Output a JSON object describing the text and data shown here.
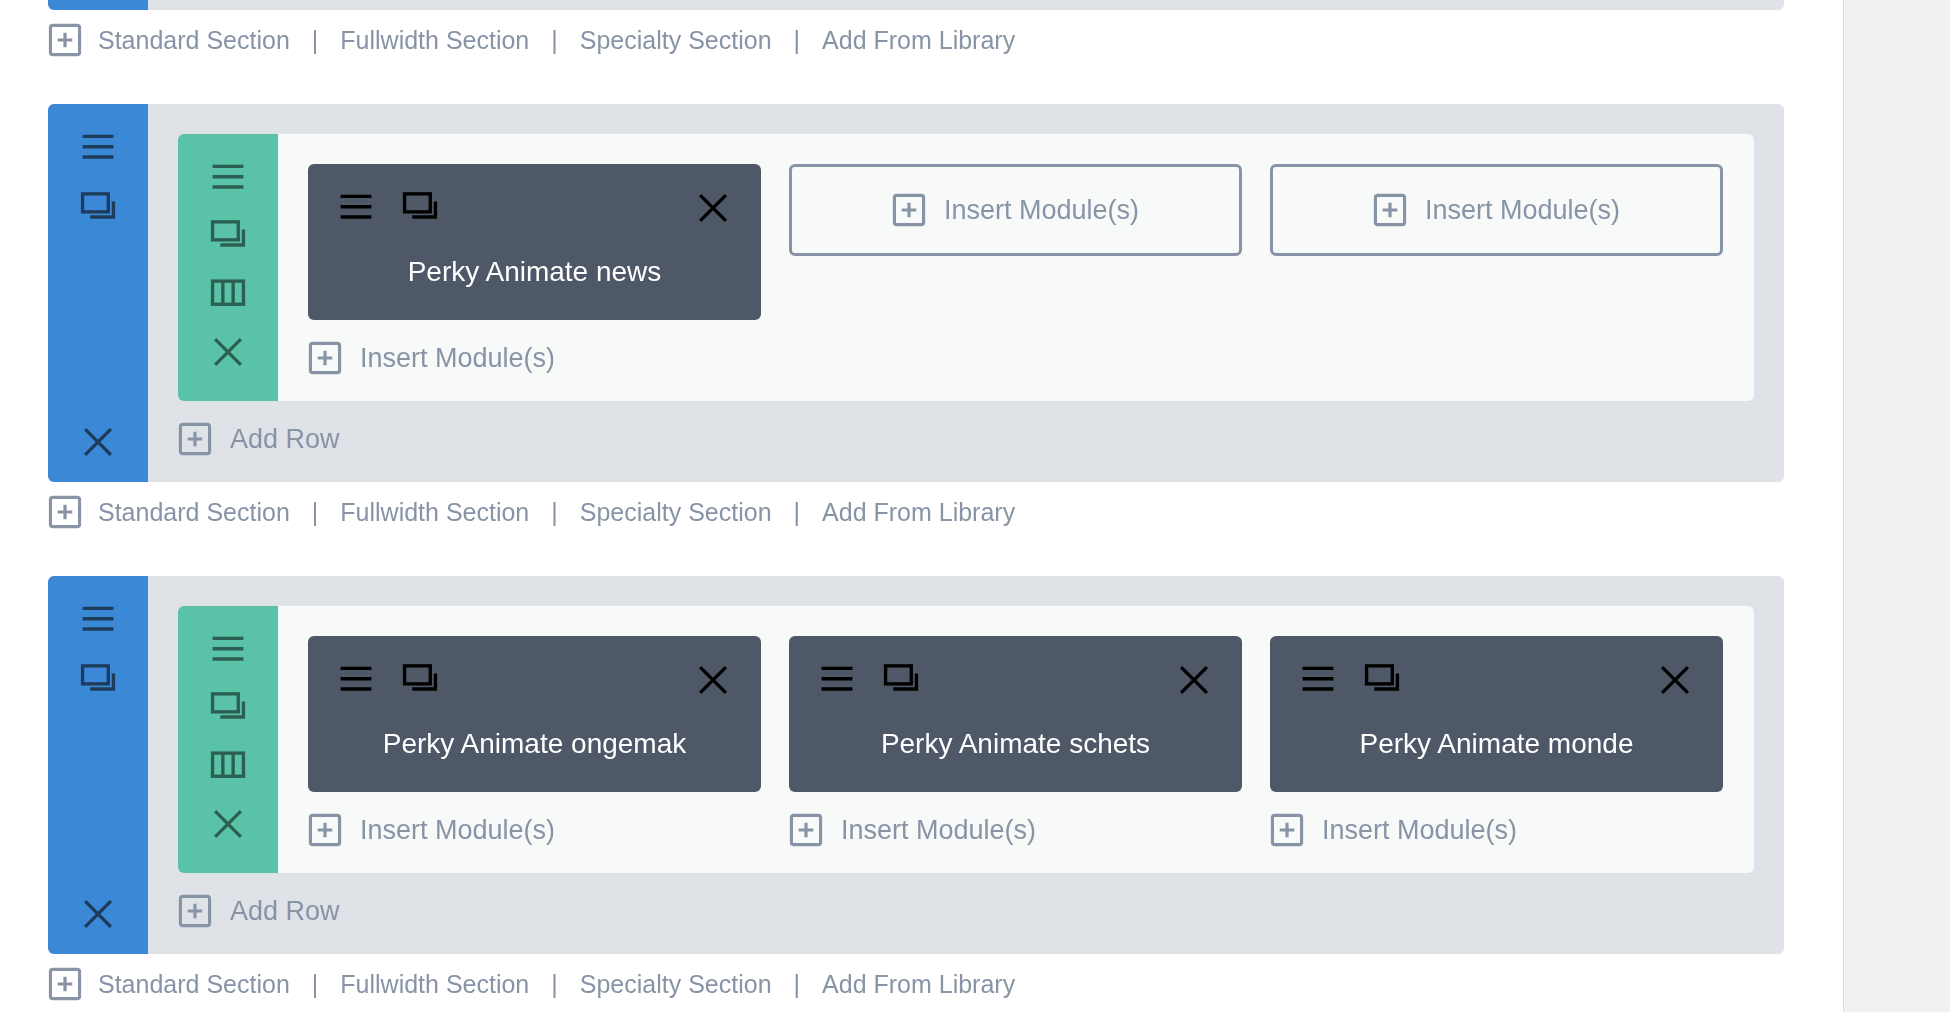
{
  "builder": [
    {
      "kind": "section_end"
    },
    {
      "kind": "add_bar",
      "separator": "|",
      "links": [
        "Standard Section",
        "Fullwidth Section",
        "Specialty Section",
        "Add From Library"
      ]
    },
    {
      "kind": "section",
      "add_row": "Add Row",
      "rows": [
        {
          "columns": [
            {
              "modules": [
                {
                  "title": "Perky Animate news"
                }
              ],
              "insert": "Insert Module(s)"
            },
            {
              "insert": "Insert Module(s)"
            },
            {
              "insert": "Insert Module(s)"
            }
          ]
        }
      ]
    },
    {
      "kind": "add_bar",
      "separator": "|",
      "links": [
        "Standard Section",
        "Fullwidth Section",
        "Specialty Section",
        "Add From Library"
      ]
    },
    {
      "kind": "section",
      "add_row": "Add Row",
      "rows": [
        {
          "columns": [
            {
              "modules": [
                {
                  "title": "Perky Animate ongemak"
                }
              ],
              "insert": "Insert Module(s)"
            },
            {
              "modules": [
                {
                  "title": "Perky Animate schets"
                }
              ],
              "insert": "Insert Module(s)"
            },
            {
              "modules": [
                {
                  "title": "Perky Animate monde"
                }
              ],
              "insert": "Insert Module(s)"
            }
          ]
        }
      ]
    },
    {
      "kind": "add_bar",
      "separator": "|",
      "links": [
        "Standard Section",
        "Fullwidth Section",
        "Specialty Section",
        "Add From Library"
      ]
    }
  ]
}
